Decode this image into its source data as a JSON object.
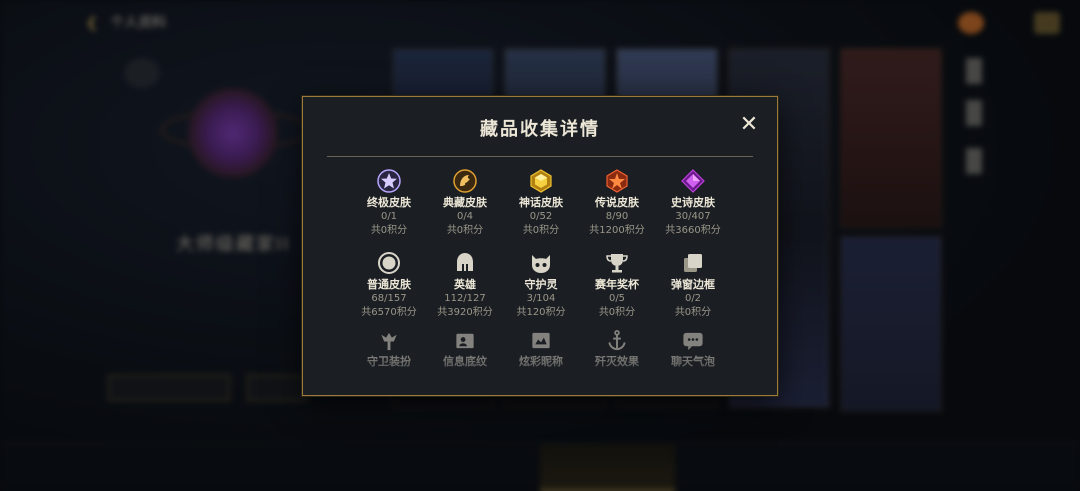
{
  "background": {
    "back_label": "个人资料",
    "player_name": "大师级藏家II",
    "player_sub": "",
    "button_a": "",
    "button_b": "",
    "bottom_tabs": [
      "",
      "",
      "",
      "",
      "",
      "",
      "",
      ""
    ]
  },
  "modal": {
    "title": "藏品收集详情",
    "close_label": "✕",
    "items": [
      {
        "name": "终极皮肤",
        "count": "0/1",
        "points": "共0积分",
        "icon": "ultimate-gem-icon",
        "color": "#b9a6ff"
      },
      {
        "name": "典藏皮肤",
        "count": "0/4",
        "points": "共0积分",
        "icon": "dragon-medal-icon",
        "color": "#e0a030"
      },
      {
        "name": "神话皮肤",
        "count": "0/52",
        "points": "共0积分",
        "icon": "mythic-gem-icon",
        "color": "#f0c030"
      },
      {
        "name": "传说皮肤",
        "count": "8/90",
        "points": "共1200积分",
        "icon": "legendary-gem-icon",
        "color": "#f06030"
      },
      {
        "name": "史诗皮肤",
        "count": "30/407",
        "points": "共3660积分",
        "icon": "epic-gem-icon",
        "color": "#c040e0"
      },
      {
        "name": "普通皮肤",
        "count": "68/157",
        "points": "共6570积分",
        "icon": "common-circle-icon",
        "color": "#d8d4c8"
      },
      {
        "name": "英雄",
        "count": "112/127",
        "points": "共3920积分",
        "icon": "helmet-icon",
        "color": "#d8d4c8"
      },
      {
        "name": "守护灵",
        "count": "3/104",
        "points": "共120积分",
        "icon": "ward-skin-icon",
        "color": "#d8d4c8"
      },
      {
        "name": "赛年奖杯",
        "count": "0/5",
        "points": "共0积分",
        "icon": "trophy-icon",
        "color": "#d8d4c8"
      },
      {
        "name": "弹窗边框",
        "count": "0/2",
        "points": "共0积分",
        "icon": "frame-icon",
        "color": "#d8d4c8"
      }
    ],
    "faded_items": [
      {
        "name": "守卫装扮",
        "icon": "ward-totem-icon"
      },
      {
        "name": "信息底纹",
        "icon": "profile-card-icon"
      },
      {
        "name": "炫彩昵称",
        "icon": "nameplate-icon"
      },
      {
        "name": "歼灭效果",
        "icon": "anchor-icon"
      },
      {
        "name": "聊天气泡",
        "icon": "chat-bubble-icon"
      }
    ]
  }
}
